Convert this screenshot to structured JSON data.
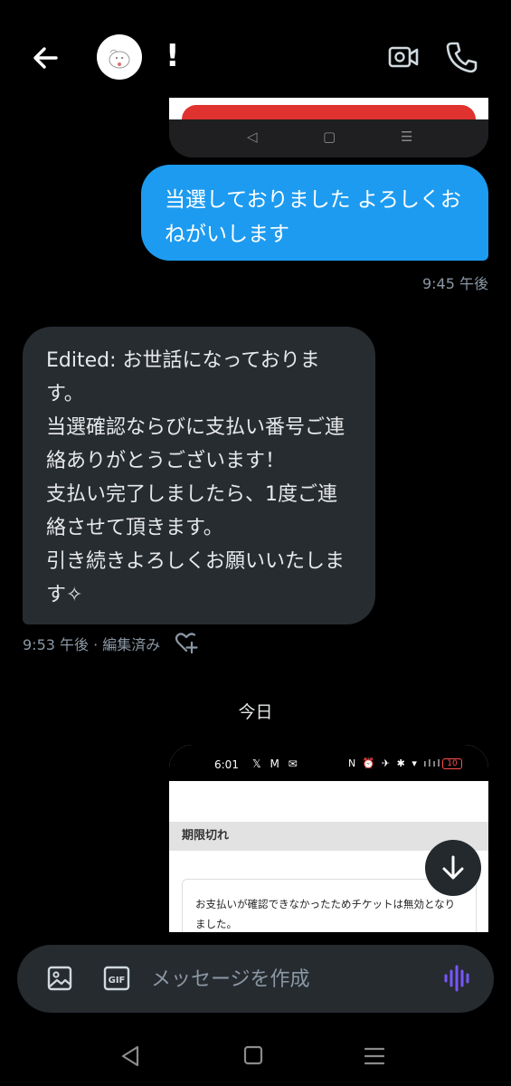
{
  "header": {
    "contact_name": "!",
    "back_icon": "arrow-left-icon",
    "video_icon": "video-camera-icon",
    "call_icon": "phone-icon"
  },
  "messages": {
    "sent_text": "当選しておりました よろしくおねがいします",
    "sent_time": "9:45 午後",
    "received_text": "Edited: お世話になっております。\n当選確認ならびに支払い番号ご連絡ありがとうございます！\n支払い完了しましたら、1度ご連絡させて頂きます。\n引き続きよろしくお願いいたします✧",
    "received_time": "9:53 午後 · 編集済み"
  },
  "date_separator": "今日",
  "screenshot_bottom": {
    "status_time": "6:01",
    "status_apps": "𝕏 M ✉",
    "status_icons": "N ⏰ ✈ ✱ ▾ ılıl",
    "battery": "10",
    "expired_label": "期限切れ",
    "notice_text": "お支払いが確認できなかったためチケットは無効となりました。"
  },
  "composer": {
    "placeholder": "メッセージを作成",
    "gif_label": "GIF"
  },
  "colors": {
    "sent_bubble": "#1d9bf0",
    "received_bubble": "#272c31",
    "voice_accent": "#7856ff"
  }
}
